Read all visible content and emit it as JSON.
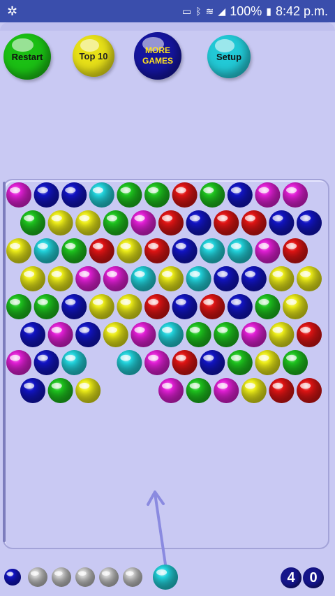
{
  "status_bar": {
    "time": "8:42 p.m.",
    "battery": "100%",
    "app_icon": "aperture-icon",
    "icons": [
      "cast-icon",
      "bluetooth-icon",
      "wifi-icon",
      "signal-icon",
      "battery-icon"
    ]
  },
  "buttons": {
    "restart": "Restart",
    "top10": "Top 10",
    "more_games": "MORE GAMES",
    "setup": "Setup"
  },
  "colors": {
    "magenta": "#e21fd6",
    "blue": "#1214c4",
    "cyan": "#22d3dc",
    "green": "#1ec41e",
    "red": "#e01414",
    "yellow": "#ecec18",
    "gray": "#c8c8c8"
  },
  "grid": {
    "rows": [
      "MBBCGGRGBMM",
      "GYYGMRBRRBB",
      "YCGRYRBCCMR",
      "YYMMCYCBBYY",
      "GGBYYRBRBGY",
      "BMBYMCGGMYR",
      "MBC.CMRBGYG",
      "BGY..MGMYRR"
    ]
  },
  "queue": {
    "remaining_color": "blue",
    "spare_shots": 5,
    "shooter_color": "cyan"
  },
  "score": {
    "digits": [
      "4",
      "0"
    ]
  }
}
